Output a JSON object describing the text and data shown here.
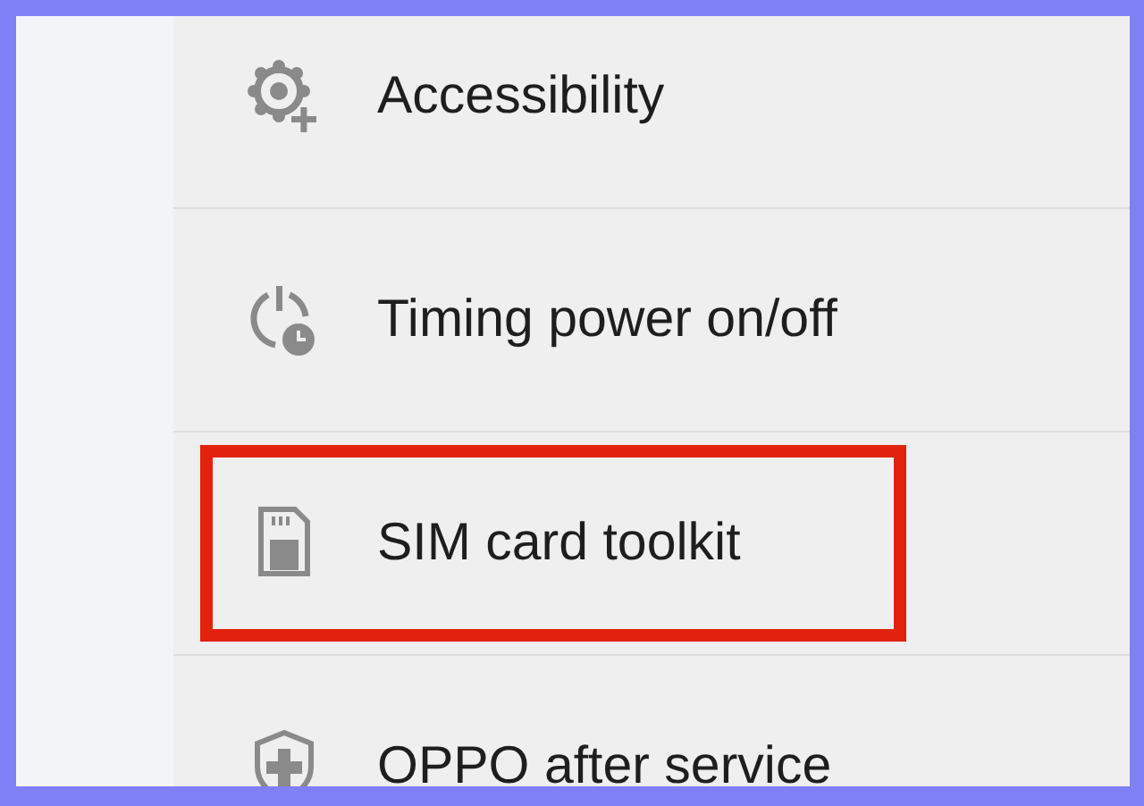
{
  "settings_items": [
    {
      "label": "Accessibility",
      "highlighted": false
    },
    {
      "label": "Timing power on/off",
      "highlighted": false
    },
    {
      "label": "SIM card toolkit",
      "highlighted": true
    },
    {
      "label": "OPPO after service",
      "highlighted": false
    }
  ]
}
